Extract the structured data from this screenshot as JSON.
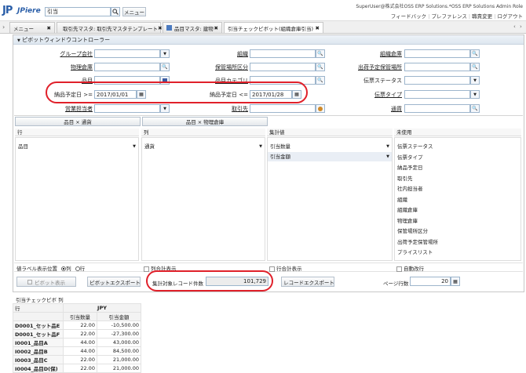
{
  "topbar": {
    "logo": "JPiere",
    "search_value": "引当",
    "menu_label": "メニュー",
    "user": "SuperUser@株式会社OSS ERP Solutions.*OSS ERP Solutions Admin Role",
    "links": [
      "フィードバック",
      "プレファレンス",
      "職責変更",
      "ログアウト"
    ]
  },
  "tabs": [
    {
      "label": "メニュー"
    },
    {
      "label": "取引先マスタ: 取引先マスタテンプレート"
    },
    {
      "label": "品目マスタ: 建物"
    },
    {
      "label": "引当チェックピボット(組織倉庫引当)"
    }
  ],
  "panel": {
    "title": "ピボットウィンドウコントローラー"
  },
  "filters": {
    "group_company": "グループ会社",
    "org": "組織",
    "org_warehouse": "組織倉庫",
    "physical_warehouse": "物理倉庫",
    "storage_area": "保管場所区分",
    "ship_storage": "出荷予定保管場所",
    "product": "品目",
    "product_category": "品目カテゴリ",
    "doc_status": "伝票ステータス",
    "date_from_label": "納品予定日 >=",
    "date_from": "2017/01/01",
    "date_to_label": "納品予定日 <=",
    "date_to": "2017/01/28",
    "doc_type": "伝票タイプ",
    "sales_rep": "営業担当者",
    "bp": "取引先",
    "currency": "通貨"
  },
  "presets": [
    "品目 × 通貨",
    "品目 × 物理倉庫"
  ],
  "columns": {
    "row": {
      "header": "行",
      "items": [
        "品目"
      ]
    },
    "col": {
      "header": "列",
      "items": [
        "通貨"
      ]
    },
    "agg": {
      "header": "集計値",
      "items": [
        "引当数量",
        "引当金額"
      ]
    },
    "unused": {
      "header": "未使用",
      "items": [
        "伝票ステータス",
        "伝票タイプ",
        "納品予定日",
        "取引先",
        "社内担当者",
        "組織",
        "組織倉庫",
        "物理倉庫",
        "保管場所区分",
        "出荷予定保管場所",
        "プライスリスト"
      ]
    }
  },
  "options": {
    "label_pos": "値ラベル表示位置",
    "col_opt": "列",
    "row_opt": "行",
    "col_total": "列合計表示",
    "row_total": "行合計表示",
    "auto_wrap": "自動改行"
  },
  "actions": {
    "pivot_show": "ピボット表示",
    "pivot_export": "ピボットエクスポート",
    "count_label": "集計対象レコード件数",
    "count_value": "101,729",
    "record_export": "レコードエクスポート",
    "page_rows_label": "ページ行数",
    "page_rows": "20"
  },
  "result": {
    "title": "引当チェックピボ 列",
    "row_label": "行",
    "currency": "JPY",
    "col1": "引当数量",
    "col2": "引当金額",
    "rows": [
      [
        "D0001_セット品E",
        "22.00",
        "-10,500.00"
      ],
      [
        "D0001_セット品F",
        "22.00",
        "-27,300.00"
      ],
      [
        "I0001_品目A",
        "44.00",
        "43,000.00"
      ],
      [
        "I0002_品目B",
        "44.00",
        "84,500.00"
      ],
      [
        "I0003_品目C",
        "22.00",
        "21,000.00"
      ],
      [
        "I0004_品目D(保)",
        "22.00",
        "21,000.00"
      ]
    ]
  }
}
